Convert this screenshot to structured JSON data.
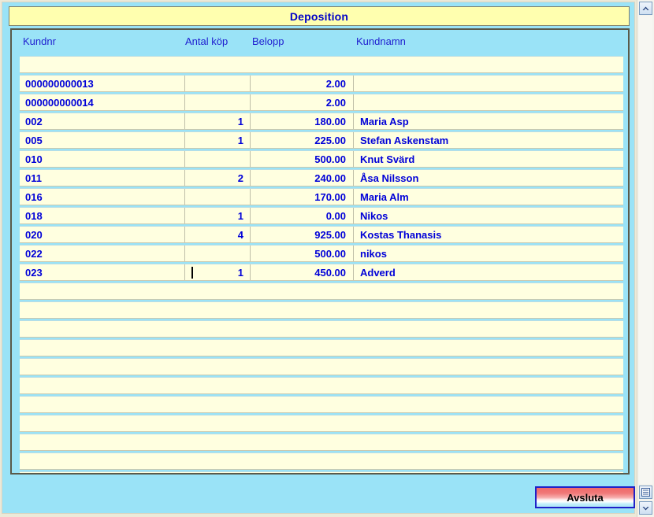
{
  "window": {
    "title": "Deposition",
    "background_color": "#9ae3f7",
    "title_background": "#ffffaf",
    "title_text_color": "#0000c8"
  },
  "table": {
    "columns": [
      "Kundnr",
      "Antal köp",
      "Belopp",
      "Kundnamn"
    ],
    "text_color": "#0000d8",
    "row_background": "#ffffe0",
    "rows": [
      {
        "kundnr": "",
        "antal": "",
        "belopp": "",
        "kundnamn": "",
        "blank": true
      },
      {
        "kundnr": "000000000013",
        "antal": "",
        "belopp": "2.00",
        "kundnamn": ""
      },
      {
        "kundnr": "000000000014",
        "antal": "",
        "belopp": "2.00",
        "kundnamn": ""
      },
      {
        "kundnr": "002",
        "antal": "1",
        "belopp": "180.00",
        "kundnamn": "Maria Asp"
      },
      {
        "kundnr": "005",
        "antal": "1",
        "belopp": "225.00",
        "kundnamn": "Stefan Askenstam"
      },
      {
        "kundnr": "010",
        "antal": "",
        "belopp": "500.00",
        "kundnamn": "Knut Svärd"
      },
      {
        "kundnr": "011",
        "antal": "2",
        "belopp": "240.00",
        "kundnamn": "Åsa Nilsson"
      },
      {
        "kundnr": "016",
        "antal": "",
        "belopp": "170.00",
        "kundnamn": "Maria Alm"
      },
      {
        "kundnr": "018",
        "antal": "1",
        "belopp": "0.00",
        "kundnamn": "Nikos"
      },
      {
        "kundnr": "020",
        "antal": "4",
        "belopp": "925.00",
        "kundnamn": "Kostas Thanasis"
      },
      {
        "kundnr": "022",
        "antal": "",
        "belopp": "500.00",
        "kundnamn": "nikos"
      },
      {
        "kundnr": "023",
        "antal": "1",
        "belopp": "450.00",
        "kundnamn": "Adverd",
        "caret_in_antal": true
      },
      {
        "kundnr": "",
        "antal": "",
        "belopp": "",
        "kundnamn": "",
        "blank": true
      },
      {
        "kundnr": "",
        "antal": "",
        "belopp": "",
        "kundnamn": "",
        "blank": true
      },
      {
        "kundnr": "",
        "antal": "",
        "belopp": "",
        "kundnamn": "",
        "blank": true
      },
      {
        "kundnr": "",
        "antal": "",
        "belopp": "",
        "kundnamn": "",
        "blank": true
      },
      {
        "kundnr": "",
        "antal": "",
        "belopp": "",
        "kundnamn": "",
        "blank": true
      },
      {
        "kundnr": "",
        "antal": "",
        "belopp": "",
        "kundnamn": "",
        "blank": true
      },
      {
        "kundnr": "",
        "antal": "",
        "belopp": "",
        "kundnamn": "",
        "blank": true
      },
      {
        "kundnr": "",
        "antal": "",
        "belopp": "",
        "kundnamn": "",
        "blank": true
      },
      {
        "kundnr": "",
        "antal": "",
        "belopp": "",
        "kundnamn": "",
        "blank": true
      },
      {
        "kundnr": "",
        "antal": "",
        "belopp": "",
        "kundnamn": "",
        "blank": true
      },
      {
        "kundnr": "",
        "antal": "",
        "belopp": "",
        "kundnamn": "",
        "blank": true
      }
    ]
  },
  "buttons": {
    "close_label": "Avsluta"
  },
  "scrollbar": {
    "up_icon": "chevron-up-icon",
    "list_icon": "list-lines-icon",
    "down_icon": "chevron-down-icon"
  }
}
